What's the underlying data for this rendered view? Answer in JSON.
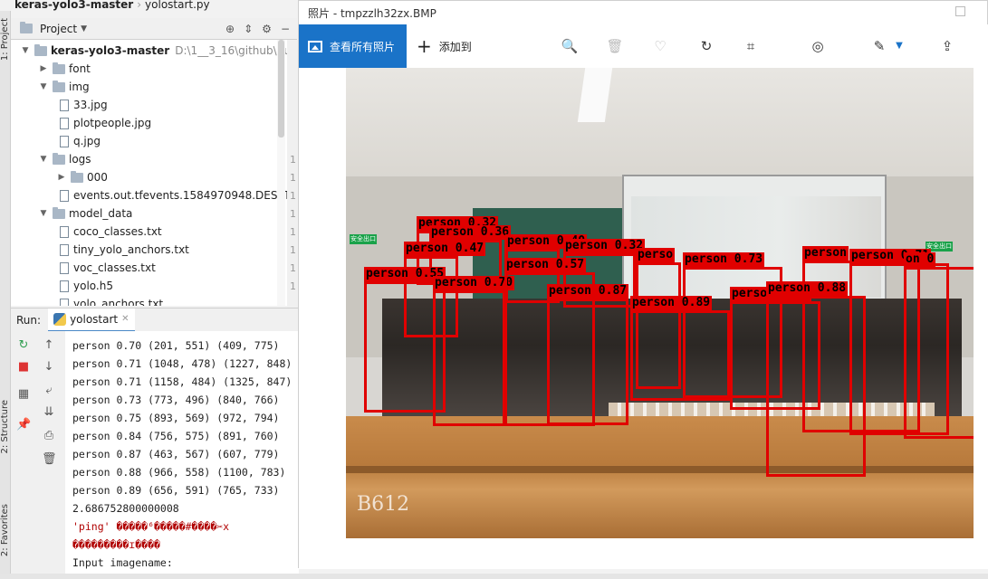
{
  "ide": {
    "breadcrumb_project": "keras-yolo3-master",
    "breadcrumb_file": "yolostart.py",
    "side_tabs": {
      "project": "1: Project",
      "structure": "2: Structure",
      "favorites": "2: Favorites"
    }
  },
  "project_panel": {
    "title": "Project",
    "tree": [
      {
        "label": "keras-yolo3-master",
        "type": "folder",
        "path": "D:\\1__3_16\\github\\huma"
      },
      {
        "label": "font",
        "type": "folder"
      },
      {
        "label": "img",
        "type": "folder"
      },
      {
        "label": "33.jpg",
        "type": "file"
      },
      {
        "label": "plotpeople.jpg",
        "type": "file"
      },
      {
        "label": "q.jpg",
        "type": "file"
      },
      {
        "label": "logs",
        "type": "folder"
      },
      {
        "label": "000",
        "type": "folder"
      },
      {
        "label": "events.out.tfevents.1584970948.DESKTO",
        "type": "file"
      },
      {
        "label": "model_data",
        "type": "folder"
      },
      {
        "label": "coco_classes.txt",
        "type": "file"
      },
      {
        "label": "tiny_yolo_anchors.txt",
        "type": "file"
      },
      {
        "label": "voc_classes.txt",
        "type": "file"
      },
      {
        "label": "yolo.h5",
        "type": "file"
      },
      {
        "label": "yolo_anchors.txt",
        "type": "file"
      }
    ],
    "gutter": [
      "1",
      "1",
      "1",
      "1",
      "1",
      "1",
      "1",
      "1"
    ]
  },
  "run_panel": {
    "label": "Run:",
    "tab": "yolostart",
    "console": [
      "person 0.70 (201, 551) (409, 775)",
      "person 0.71 (1048, 478) (1227, 848)",
      "person 0.71 (1158, 484) (1325, 847)",
      "person 0.73 (773, 496) (840, 766)",
      "person 0.75 (893, 569) (972, 794)",
      "person 0.84 (756, 575) (891, 760)",
      "person 0.87 (463, 567) (607, 779)",
      "person 0.88 (966, 558) (1100, 783)",
      "person 0.89 (656, 591) (765, 733)",
      "2.686752800000008",
      "'ping' �����⁶�����#����✂x",
      "���������ɪ����",
      "Input imagename:"
    ]
  },
  "viewer": {
    "title": "照片 - tmpzzlh32zx.BMP",
    "view_all": "查看所有照片",
    "add_to": "添加到",
    "watermark": "B612",
    "exit_sign_left": "安全出口",
    "exit_sign_right": "安全出口",
    "icons": [
      "zoom-icon",
      "delete-icon",
      "favorite-icon",
      "rotate-icon",
      "crop-icon",
      "enhance-icon",
      "edit-icon",
      "share-icon"
    ]
  },
  "detections": [
    {
      "label": "person 0.32",
      "score": 0.32
    },
    {
      "label": "person 0.36",
      "score": 0.36
    },
    {
      "label": "person 0.47",
      "score": 0.47
    },
    {
      "label": "person 0.40",
      "score": 0.4
    },
    {
      "label": "person 0.32",
      "score": 0.32
    },
    {
      "label": "person 0.55",
      "score": 0.55
    },
    {
      "label": "person 0.70",
      "score": 0.7
    },
    {
      "label": "person 0.57",
      "score": 0.57
    },
    {
      "label": "person 0.87",
      "score": 0.87
    },
    {
      "label": "perso",
      "score": null
    },
    {
      "label": "person 0.73",
      "score": 0.73
    },
    {
      "label": "person 0.89",
      "score": 0.89
    },
    {
      "label": "person 0.84",
      "score": 0.84
    },
    {
      "label": "person",
      "score": null
    },
    {
      "label": "person 0.71",
      "score": 0.71
    },
    {
      "label": "person 0.88",
      "score": 0.88
    },
    {
      "label": "on 0",
      "score": null
    }
  ],
  "colors": {
    "accent": "#1a73c8",
    "box": "#e00000"
  }
}
